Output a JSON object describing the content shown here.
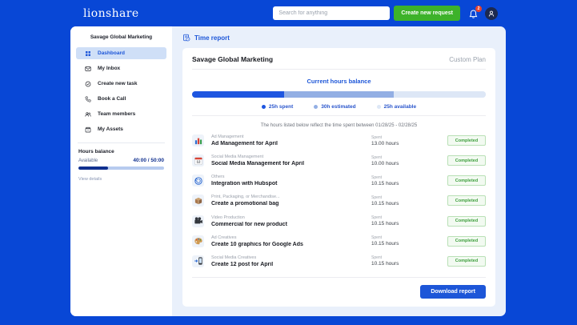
{
  "header": {
    "logo": "lionshare",
    "search_placeholder": "Search for anything",
    "create_request_label": "Create new request",
    "notification_count": "2"
  },
  "sidebar": {
    "client_name": "Savage Global Marketing",
    "items": [
      {
        "label": "Dashboard"
      },
      {
        "label": "My Inbox"
      },
      {
        "label": "Create new task"
      },
      {
        "label": "Book a Call"
      },
      {
        "label": "Team members"
      },
      {
        "label": "My Assets"
      }
    ],
    "hours_balance": {
      "title": "Hours balance",
      "available_label": "Available",
      "value": "40:00 / 50:00",
      "view_details_label": "View details",
      "fill_percent": 35
    }
  },
  "main": {
    "page_title": "Time report",
    "card": {
      "client_name": "Savage Global Marketing",
      "plan_label": "Custom Plan",
      "balance_title": "Current hours balance",
      "note": "The hours listed below reflect the time spent between 01/28/25 - 02/28/25",
      "download_button_label": "Download report"
    }
  },
  "hours_balance_bar": {
    "total_hours": 80,
    "segments": [
      {
        "name": "spent",
        "hours": 25,
        "label": "25h spent",
        "color": "#1e56e0"
      },
      {
        "name": "estimated",
        "hours": 30,
        "label": "30h estimated",
        "color": "#93afe4"
      },
      {
        "name": "available",
        "hours": 25,
        "label": "25h available",
        "color": "#dde7f6"
      }
    ]
  },
  "tasks": [
    {
      "category": "Ad Management",
      "title": "Ad Management for April",
      "spent_label": "Spent",
      "hours": "13.00 hours",
      "status": "Completed"
    },
    {
      "category": "Social Media Management",
      "title": "Social Media Management for April",
      "spent_label": "Spent",
      "hours": "10.00 hours",
      "status": "Completed"
    },
    {
      "category": "Others",
      "title": "Integration with Hubspot",
      "spent_label": "Spent",
      "hours": "10.15 hours",
      "status": "Completed"
    },
    {
      "category": "Print, Packaging, or Merchandise...",
      "title": "Create a promotional bag",
      "spent_label": "Spent",
      "hours": "10.15 hours",
      "status": "Completed"
    },
    {
      "category": "Video Production",
      "title": "Commercial for new product",
      "spent_label": "Spent",
      "hours": "10.15 hours",
      "status": "Completed"
    },
    {
      "category": "Ad Creatives",
      "title": "Create 10 graphics for Google Ads",
      "spent_label": "Spent",
      "hours": "10.15 hours",
      "status": "Completed"
    },
    {
      "category": "Social Media Creatives",
      "title": "Create 12 post for April",
      "spent_label": "Spent",
      "hours": "10.15 hours",
      "status": "Completed"
    }
  ]
}
